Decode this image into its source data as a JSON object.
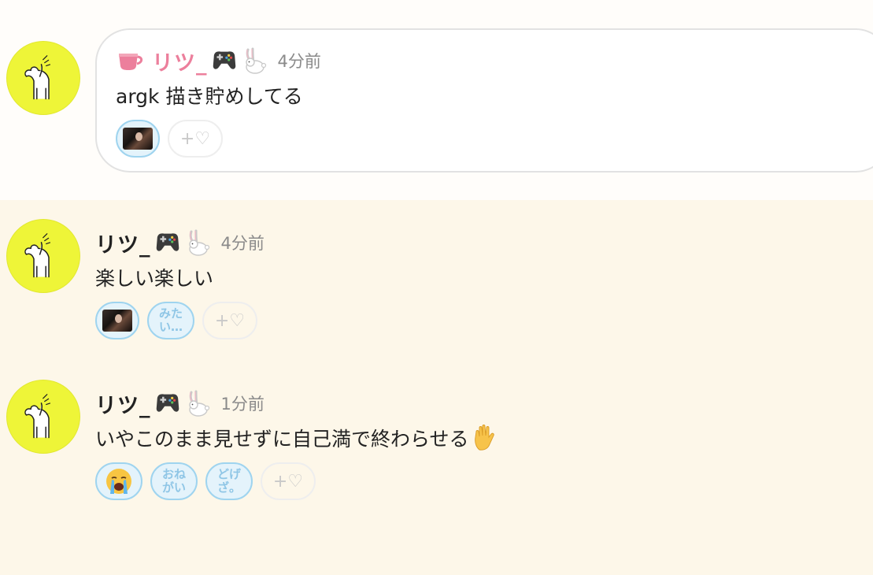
{
  "colors": {
    "accent_name": "#ec7f9c",
    "avatar_bg": "#eef538",
    "reaction_border": "#9fd4ef",
    "page_bg": "#fdf7e9"
  },
  "posts": [
    {
      "name": "リツ_",
      "name_suffix_icons": [
        "game-controller-icon",
        "rabbit-icon"
      ],
      "prefix_icon": "coffee-cup-icon",
      "time": "4分前",
      "text": "argk 描き貯めしてる",
      "reactions": [
        {
          "type": "image",
          "icon": "photo-reaction-icon"
        }
      ],
      "add_reaction_label": "+♡"
    },
    {
      "name": "リツ_",
      "name_suffix_icons": [
        "game-controller-icon",
        "rabbit-icon"
      ],
      "time": "4分前",
      "text": "楽しい楽しい",
      "reactions": [
        {
          "type": "image",
          "icon": "photo-reaction-icon"
        },
        {
          "type": "text",
          "label": "みたい…"
        }
      ],
      "add_reaction_label": "+♡"
    },
    {
      "name": "リツ_",
      "name_suffix_icons": [
        "game-controller-icon",
        "rabbit-icon"
      ],
      "time": "1分前",
      "text": "いやこのまま見せずに自己満で終わらせる",
      "trailing_icon": "raised-hand-icon",
      "reactions": [
        {
          "type": "emoji",
          "icon": "crying-face-icon"
        },
        {
          "type": "text",
          "label": "おねがい"
        },
        {
          "type": "text",
          "label": "どげざ。"
        }
      ],
      "add_reaction_label": "+♡"
    }
  ]
}
